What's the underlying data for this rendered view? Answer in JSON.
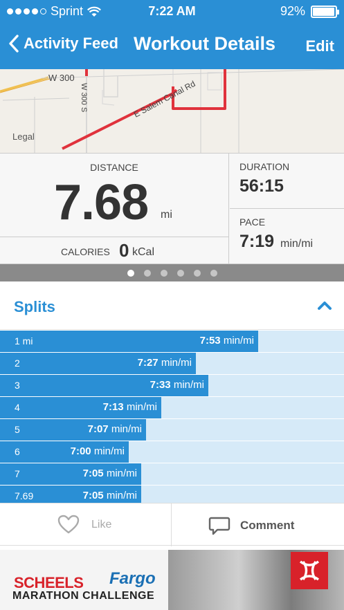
{
  "status": {
    "carrier": "Sprint",
    "time": "7:22 AM",
    "battery": "92%",
    "battery_level": 0.92
  },
  "nav": {
    "back_label": "Activity Feed",
    "title": "Workout Details",
    "edit_label": "Edit"
  },
  "map": {
    "legal": "Legal",
    "road_labels": [
      "W 300",
      "E Salem Canal Rd",
      "W 300 S"
    ]
  },
  "stats": {
    "distance_label": "DISTANCE",
    "distance": "7.68",
    "distance_unit": "mi",
    "calories_label": "CALORIES",
    "calories": "0",
    "calories_unit": "kCal",
    "duration_label": "DURATION",
    "duration": "56:15",
    "pace_label": "PACE",
    "pace": "7:19",
    "pace_unit": "min/mi"
  },
  "pager": {
    "count": 6,
    "active": 0
  },
  "splits": {
    "title": "Splits",
    "unit": "min/mi",
    "rows": [
      {
        "mile": "1 mi",
        "pace": "7:53",
        "fraction": 0.75
      },
      {
        "mile": "2",
        "pace": "7:27",
        "fraction": 0.57
      },
      {
        "mile": "3",
        "pace": "7:33",
        "fraction": 0.605
      },
      {
        "mile": "4",
        "pace": "7:13",
        "fraction": 0.468
      },
      {
        "mile": "5",
        "pace": "7:07",
        "fraction": 0.425
      },
      {
        "mile": "6",
        "pace": "7:00",
        "fraction": 0.375
      },
      {
        "mile": "7",
        "pace": "7:05",
        "fraction": 0.41
      },
      {
        "mile": "7.69",
        "pace": "7:05",
        "fraction": 0.41
      }
    ]
  },
  "actions": {
    "like_label": "Like",
    "comment_label": "Comment"
  },
  "ad": {
    "brand": "SCHEELS",
    "event": "Fargo",
    "tagline": "MARATHON CHALLENGE"
  },
  "colors": {
    "accent": "#2a8fd5",
    "split_bg": "#d6eaf8",
    "route": "#e0323c"
  }
}
